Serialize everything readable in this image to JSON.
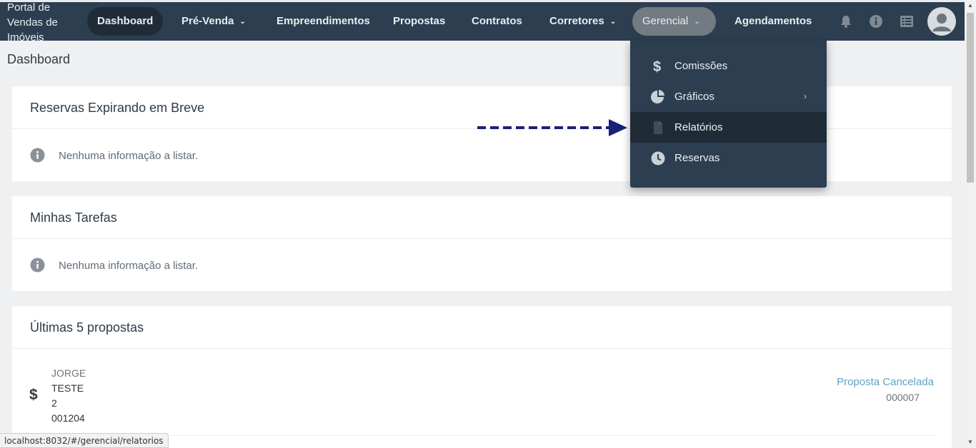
{
  "brand": {
    "title": "Portal de Vendas de Imóveis"
  },
  "nav": {
    "dashboard": "Dashboard",
    "pre_venda": "Pré-Venda",
    "empreendimentos": "Empreendimentos",
    "propostas": "Propostas",
    "contratos": "Contratos",
    "corretores": "Corretores",
    "gerencial": "Gerencial",
    "agendamentos": "Agendamentos"
  },
  "icons": {
    "notifications": "bell-icon",
    "help": "info-icon",
    "list": "list-icon",
    "user": "user-avatar-icon"
  },
  "dropdown": {
    "items": [
      {
        "label": "Comissões",
        "icon": "dollar-icon"
      },
      {
        "label": "Gráficos",
        "icon": "pie-chart-icon",
        "submenu": "›"
      },
      {
        "label": "Relatórios",
        "icon": "document-icon"
      },
      {
        "label": "Reservas",
        "icon": "clock-icon"
      }
    ]
  },
  "page": {
    "title": "Dashboard"
  },
  "cards": {
    "reservas": {
      "title": "Reservas Expirando em Breve",
      "empty": "Nenhuma informação a listar."
    },
    "tarefas": {
      "title": "Minhas Tarefas",
      "empty": "Nenhuma informação a listar."
    },
    "propostas": {
      "title": "Últimas 5 propostas",
      "row": {
        "line1": "JORGE",
        "line2": "TESTE",
        "line3": "2",
        "line4": "001204",
        "status": "Proposta Cancelada",
        "code": "000007"
      }
    }
  },
  "status_url": "localhost:8032/#/gerencial/relatorios",
  "colors": {
    "nav_bg": "#2c3e50",
    "status_link": "#5fa3c7",
    "arrow": "#1a1f78"
  }
}
